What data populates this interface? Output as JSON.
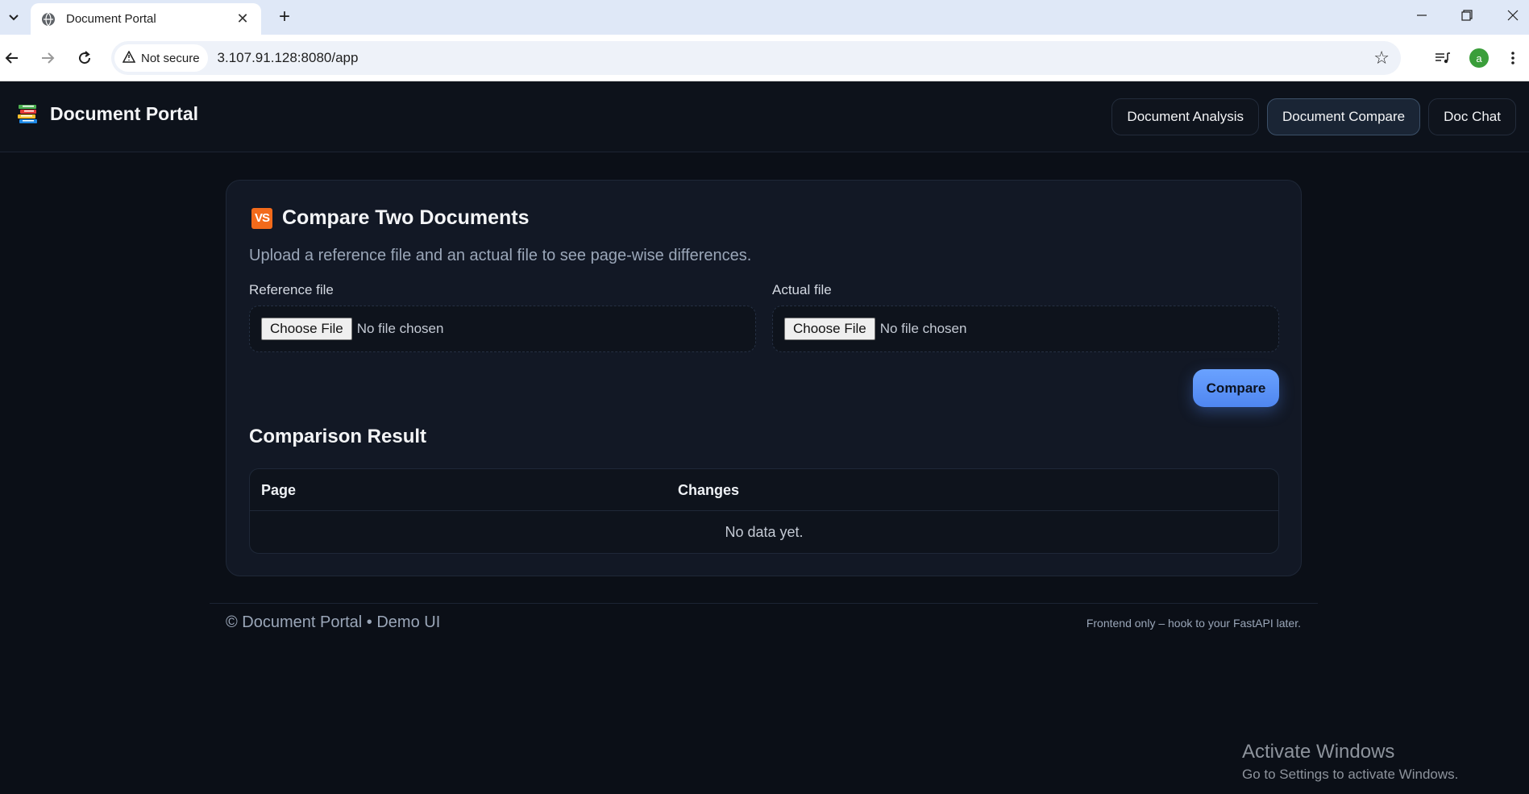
{
  "browser": {
    "tab_title": "Document Portal",
    "tab_close": "✕",
    "new_tab": "+",
    "security_label": "Not secure",
    "url": "3.107.91.128:8080/app",
    "profile_initial": "a"
  },
  "app": {
    "brand": "Document Portal",
    "nav": [
      {
        "label": "Document Analysis",
        "active": false
      },
      {
        "label": "Document Compare",
        "active": true
      },
      {
        "label": "Doc Chat",
        "active": false
      }
    ]
  },
  "compare": {
    "badge": "VS",
    "title": "Compare Two Documents",
    "subtitle": "Upload a reference file and an actual file to see page-wise differences.",
    "reference_label": "Reference file",
    "actual_label": "Actual file",
    "choose_file": "Choose File",
    "no_file": "No file chosen",
    "compare_button": "Compare"
  },
  "result": {
    "title": "Comparison Result",
    "columns": [
      "Page",
      "Changes"
    ],
    "empty": "No data yet."
  },
  "footer": {
    "left": "© Document Portal • Demo UI",
    "right": "Frontend only – hook to your FastAPI later."
  },
  "os_watermark": {
    "line1": "Activate Windows",
    "line2": "Go to Settings to activate Windows."
  },
  "colors": {
    "accent": "#5b93f8",
    "background": "#0b0f17",
    "card": "#121825",
    "vs_badge": "#f26a1b"
  }
}
